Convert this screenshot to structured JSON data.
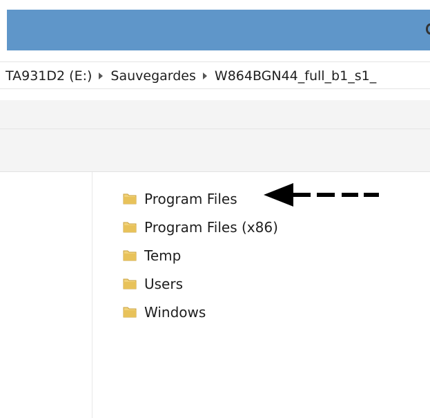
{
  "breadcrumb": {
    "items": [
      "TA931D2 (E:)",
      "Sauvegardes",
      "W864BGN44_full_b1_s1_"
    ]
  },
  "files": [
    {
      "name": "Program Files",
      "icon": "folder-icon"
    },
    {
      "name": "Program Files (x86)",
      "icon": "folder-icon"
    },
    {
      "name": "Temp",
      "icon": "folder-icon"
    },
    {
      "name": "Users",
      "icon": "folder-icon"
    },
    {
      "name": "Windows",
      "icon": "folder-icon"
    }
  ],
  "annotation": {
    "icon": "left-arrow-icon",
    "points_to": "Program Files"
  },
  "colors": {
    "titlebar": "#5f96c9",
    "folder": "#e8c25a",
    "arrow": "#000000"
  }
}
